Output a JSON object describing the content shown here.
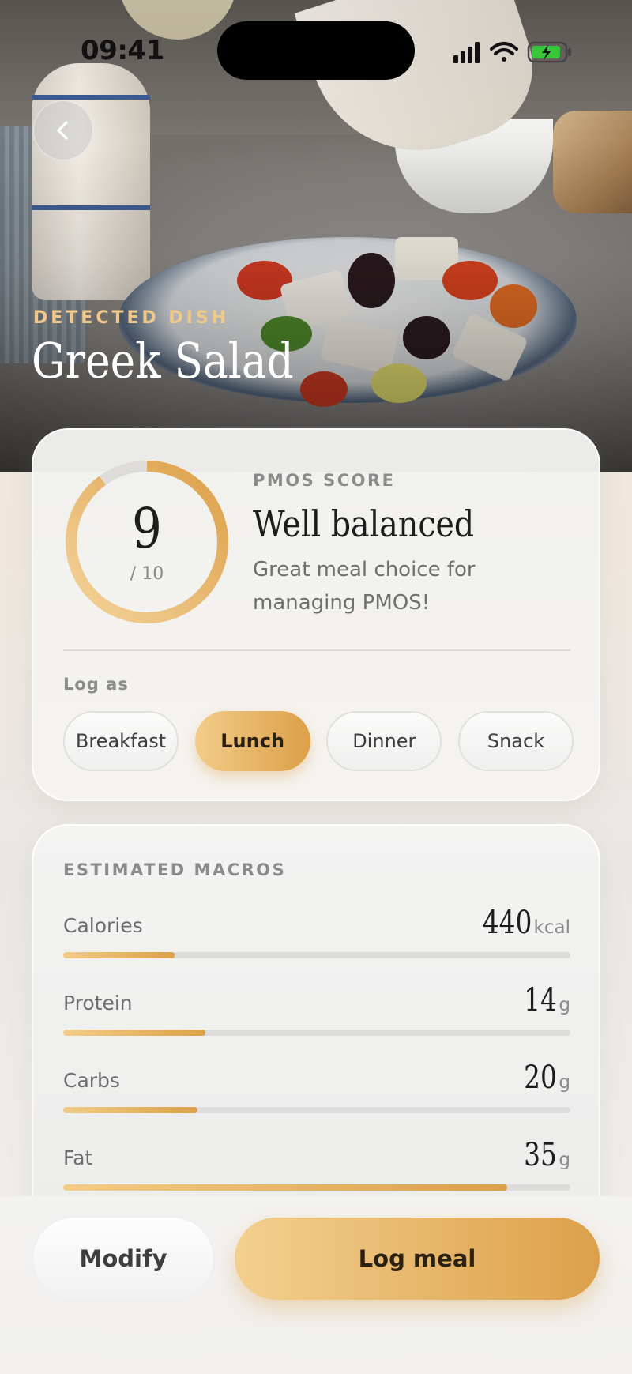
{
  "status_bar": {
    "time": "09:41"
  },
  "hero": {
    "eyebrow": "DETECTED DISH",
    "dish_name": "Greek Salad"
  },
  "score_card": {
    "score_value": "9",
    "score_max": "/ 10",
    "score_fraction": 0.9,
    "label": "PMOS SCORE",
    "title": "Well balanced",
    "description": "Great meal choice for managing PMOS!",
    "log_as_label": "Log as",
    "meal_options": [
      "Breakfast",
      "Lunch",
      "Dinner",
      "Snack"
    ],
    "selected_meal": "Lunch"
  },
  "macros_card": {
    "title": "ESTIMATED MACROS",
    "items": [
      {
        "name": "Calories",
        "value": "440",
        "unit": "kcal",
        "fraction": 0.22
      },
      {
        "name": "Protein",
        "value": "14",
        "unit": "g",
        "fraction": 0.28
      },
      {
        "name": "Carbs",
        "value": "20",
        "unit": "g",
        "fraction": 0.265
      },
      {
        "name": "Fat",
        "value": "35",
        "unit": "g",
        "fraction": 0.875
      }
    ]
  },
  "actions": {
    "modify_label": "Modify",
    "log_label": "Log meal"
  },
  "colors": {
    "accent_light": "#f2cc88",
    "accent_dark": "#dca049",
    "track": "#dedcda"
  },
  "icons": {
    "back": "chevron-left-icon",
    "signal": "cellular-signal-icon",
    "wifi": "wifi-icon",
    "battery": "battery-charging-icon"
  }
}
